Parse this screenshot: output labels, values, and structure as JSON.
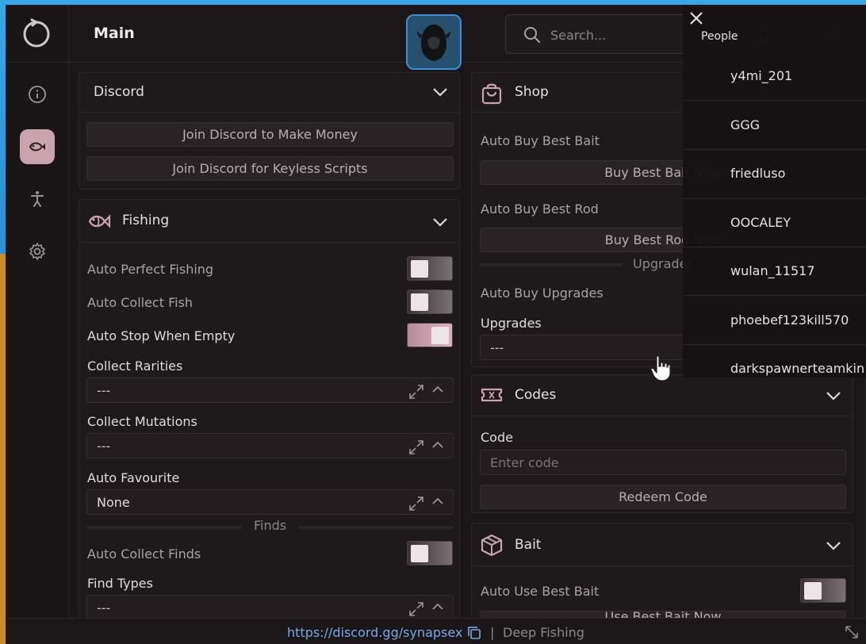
{
  "header": {
    "title": "Main",
    "search_placeholder": "Search...",
    "people_label": "People"
  },
  "sidebar": {
    "items": [
      {
        "icon": "info-icon"
      },
      {
        "icon": "fish-icon",
        "active": true
      },
      {
        "icon": "person-icon"
      },
      {
        "icon": "gear-icon"
      }
    ]
  },
  "discord": {
    "title": "Discord",
    "btn_money": "Join Discord to Make Money",
    "btn_keyless": "Join Discord for Keyless Scripts"
  },
  "fishing": {
    "title": "Fishing",
    "auto_perfect": "Auto Perfect Fishing",
    "auto_collect": "Auto Collect Fish",
    "auto_stop": "Auto Stop When Empty",
    "collect_rarities": "Collect Rarities",
    "collect_rarities_value": "---",
    "collect_mutations": "Collect Mutations",
    "collect_mutations_value": "---",
    "auto_favourite": "Auto Favourite",
    "auto_favourite_value": "None",
    "finds_divider": "Finds",
    "auto_collect_finds": "Auto Collect Finds",
    "find_types": "Find Types",
    "find_types_value": "---",
    "toggles": {
      "auto_perfect": false,
      "auto_collect": false,
      "auto_stop": true,
      "auto_collect_finds": false
    }
  },
  "shop": {
    "title": "Shop",
    "auto_buy_bait": "Auto Buy Best Bait",
    "buy_bait_btn": "Buy Best Bait Now",
    "auto_buy_rod": "Auto Buy Best Rod",
    "buy_rod_btn": "Buy Best Rod Now",
    "upgrades_divider": "Upgrades",
    "auto_buy_upgrades": "Auto Buy Upgrades",
    "upgrades": "Upgrades",
    "upgrades_value": "---"
  },
  "codes": {
    "title": "Codes",
    "code_label": "Code",
    "code_placeholder": "Enter code",
    "redeem_btn": "Redeem Code"
  },
  "bait": {
    "title": "Bait",
    "auto_use": "Auto Use Best Bait",
    "use_btn": "Use Best Bait Now"
  },
  "people": {
    "players": [
      "y4mi_201",
      "GGG",
      "friedluso",
      "OOCALEY",
      "wulan_11517",
      "phoebef123kill570",
      "darkspawnerteamkin"
    ]
  },
  "footer": {
    "link": "https://discord.gg/synapsex",
    "separator": "|",
    "game": "Deep Fishing"
  },
  "colors": {
    "accent": "#c9a3ae",
    "link": "#7aa8e6",
    "panel_bg": "#1e191b"
  }
}
